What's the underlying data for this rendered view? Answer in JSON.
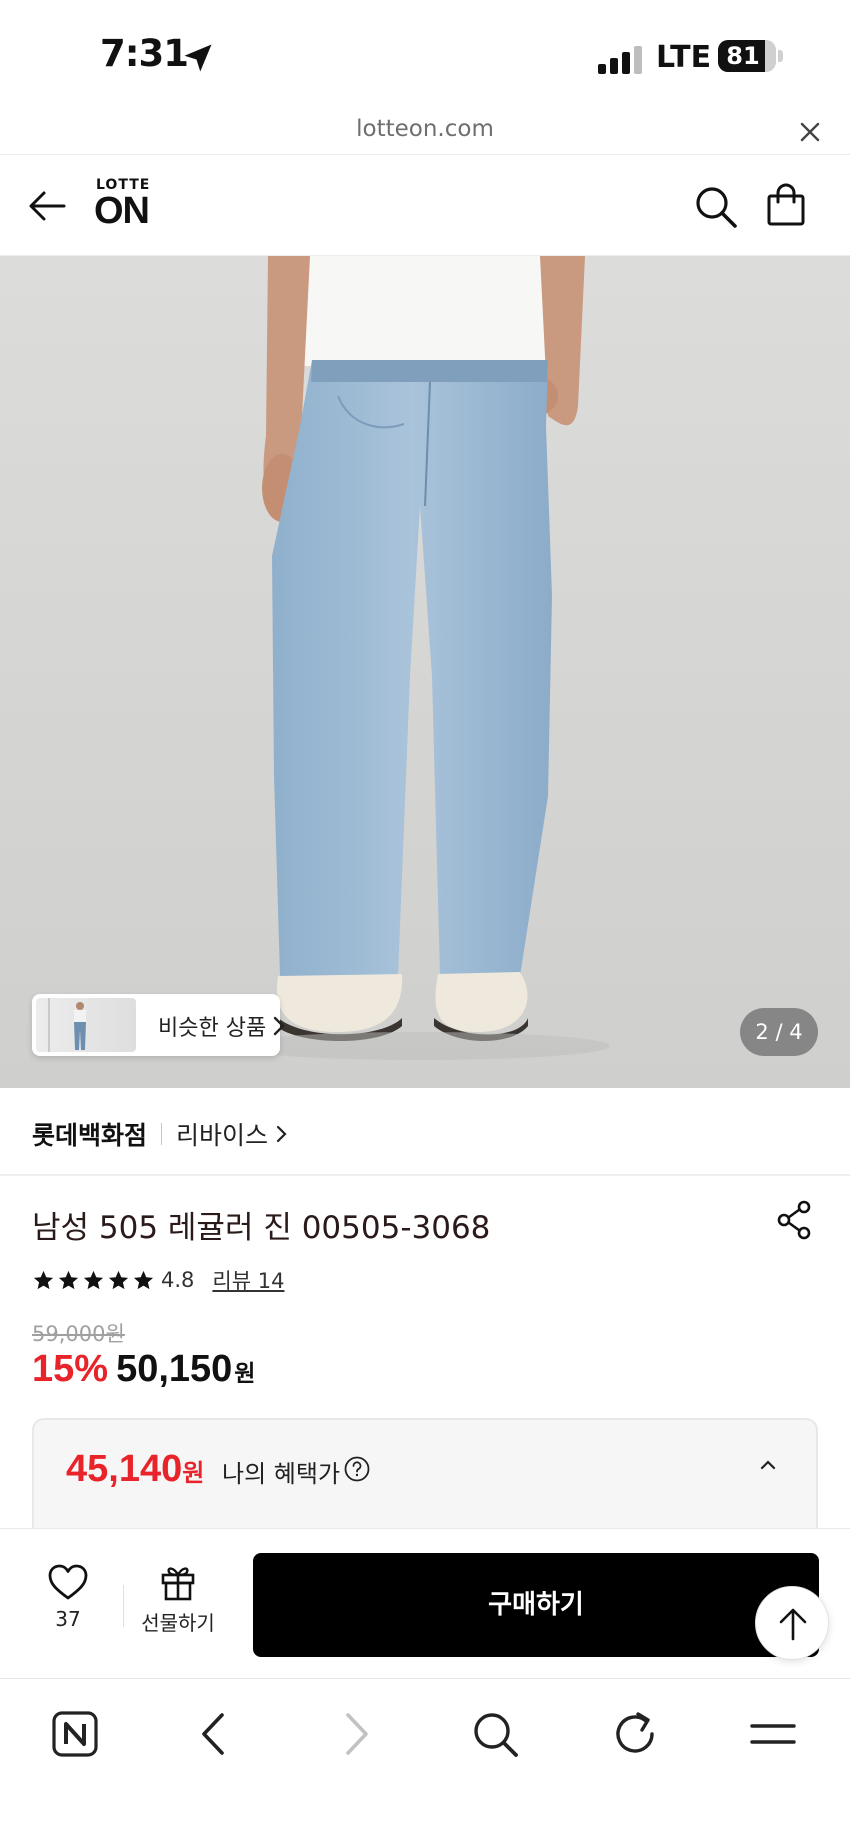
{
  "status_bar": {
    "time": "7:31",
    "network": "LTE",
    "battery": "81",
    "battery_level": 0.81
  },
  "url_bar": {
    "url": "lotteon.com",
    "close_icon": "close-icon"
  },
  "header": {
    "logo_top": "LOTTE",
    "logo_main": "ON",
    "back_icon": "back-arrow-icon",
    "search_icon": "search-icon",
    "cart_icon": "shopping-bag-icon"
  },
  "hero": {
    "similar_label": "비슷한 상품",
    "page_indicator": "2 / 4"
  },
  "breadcrumb": {
    "store": "롯데백화점",
    "brand": "리바이스"
  },
  "product": {
    "title": "남성 505 레귤러 진 00505-3068",
    "rating": "4.8",
    "rating_stars": 5,
    "review_link": "리뷰 14",
    "original_price": "59,000원",
    "discount": "15%",
    "sale_price": "50,150",
    "currency": "원"
  },
  "benefit": {
    "amount": "45,140",
    "currency": "원",
    "label": "나의 혜택가"
  },
  "action_bar": {
    "like_count": "37",
    "gift_label": "선물하기",
    "buy_label": "구매하기"
  },
  "colors": {
    "accent_red": "#e8232a",
    "buy_button": "#000000"
  }
}
